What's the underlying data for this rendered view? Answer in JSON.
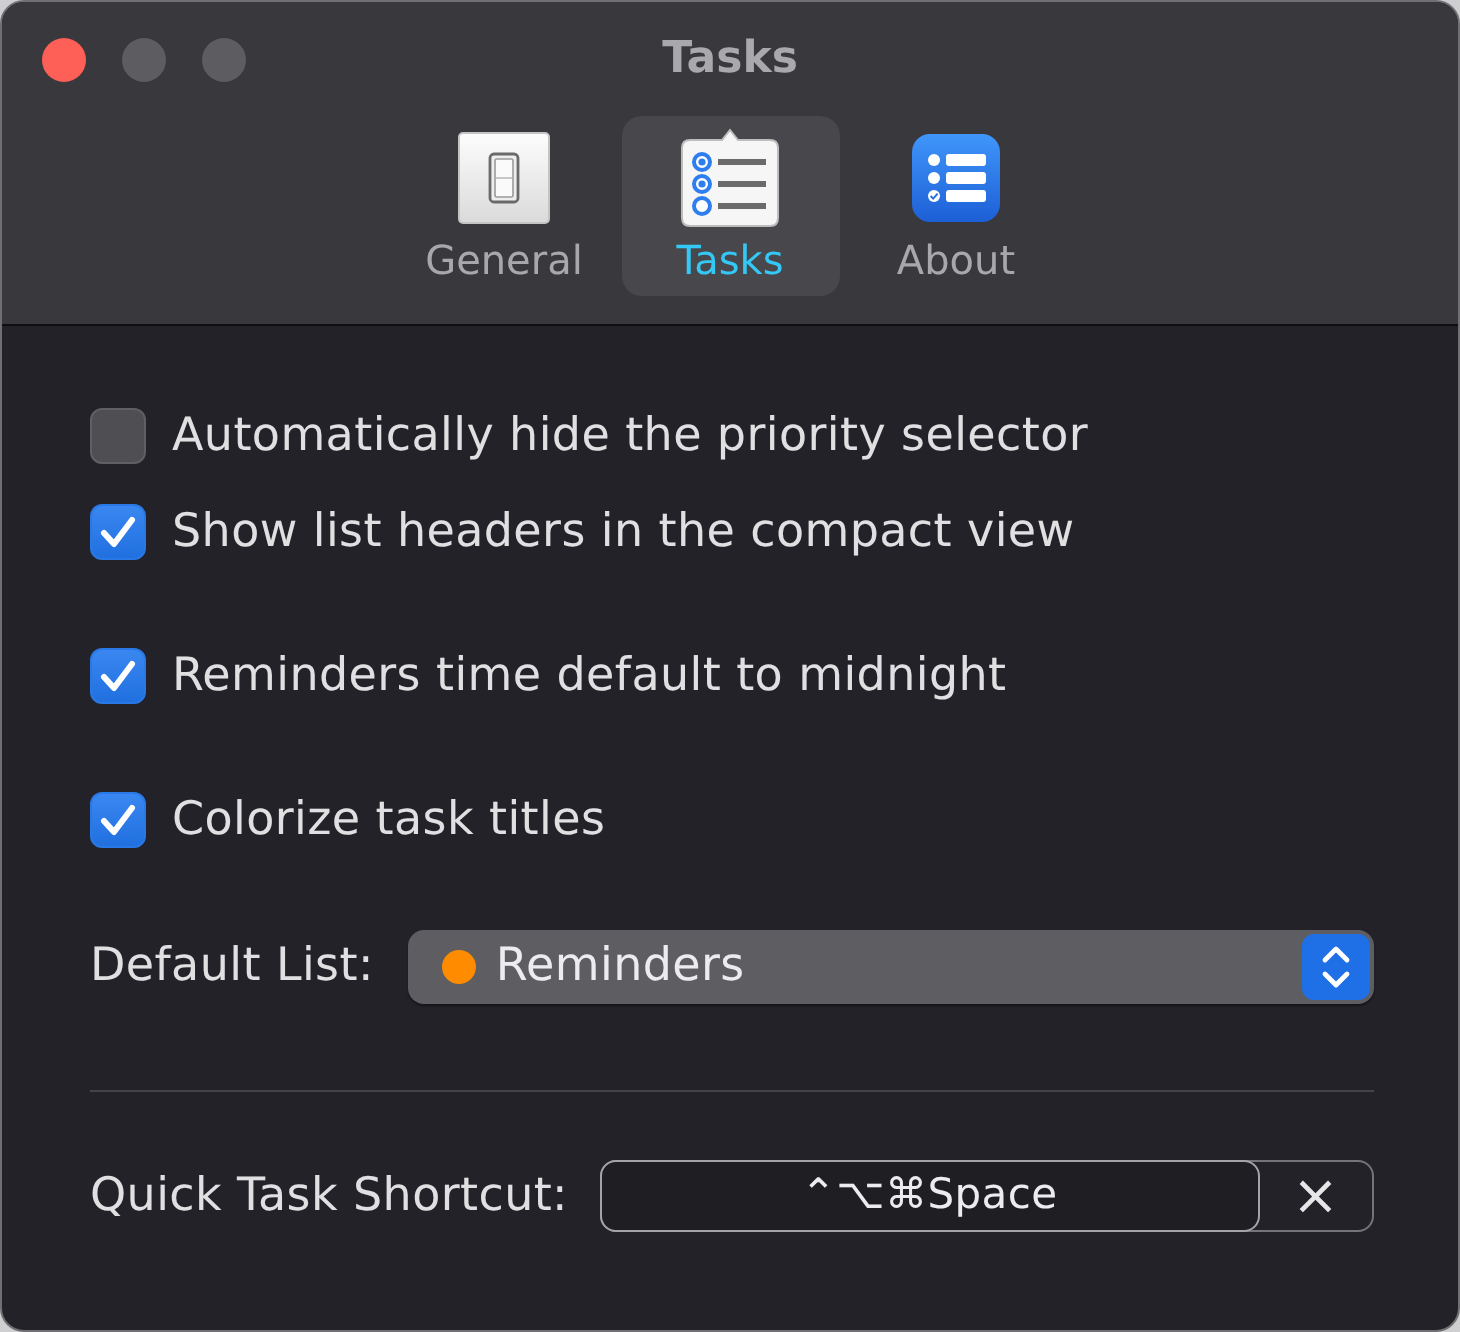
{
  "window": {
    "title": "Tasks"
  },
  "tabs": [
    {
      "label": "General",
      "selected": false
    },
    {
      "label": "Tasks",
      "selected": true
    },
    {
      "label": "About",
      "selected": false
    }
  ],
  "option_groups": [
    {
      "options": [
        {
          "label": "Automatically hide the priority selector",
          "checked": false
        },
        {
          "label": "Show list headers in the compact view",
          "checked": true
        }
      ]
    },
    {
      "options": [
        {
          "label": "Reminders time default to midnight",
          "checked": true
        }
      ]
    },
    {
      "options": [
        {
          "label": "Colorize task titles",
          "checked": true
        }
      ]
    }
  ],
  "default_list": {
    "label": "Default List:",
    "value": "Reminders",
    "color": "#ff8c00"
  },
  "quick_task_shortcut": {
    "label": "Quick Task Shortcut:",
    "value": "⌃⌥⌘Space",
    "clear": "×"
  }
}
